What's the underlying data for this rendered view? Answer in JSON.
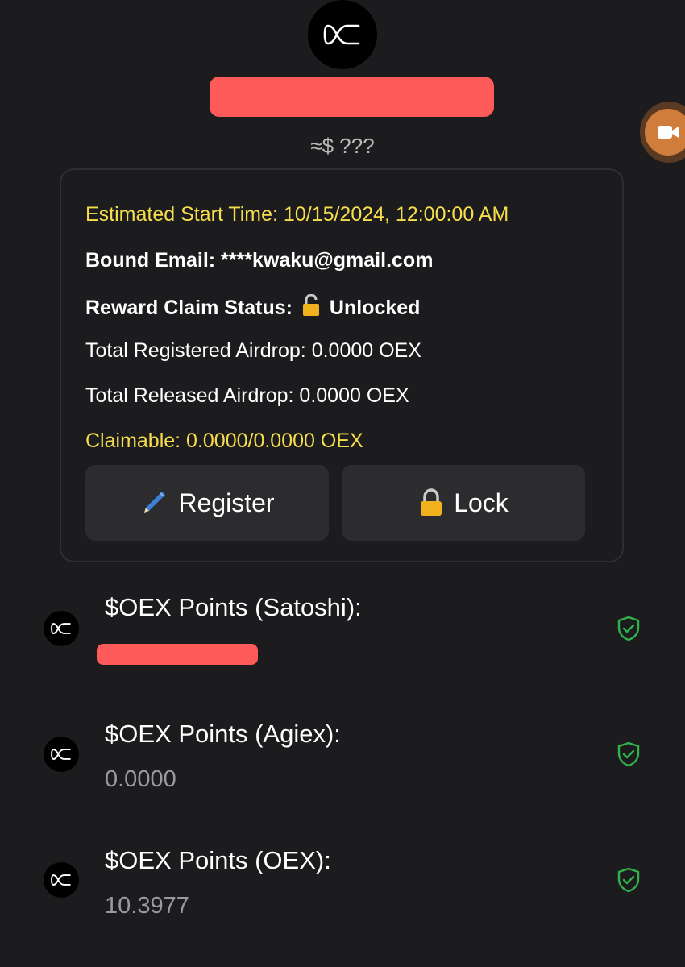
{
  "header": {
    "approx_value": "≈$ ???"
  },
  "card": {
    "start_time": "Estimated Start Time: 10/15/2024, 12:00:00 AM",
    "email_label": "Bound Email: ****kwaku@gmail.com",
    "claim_status_label": "Reward Claim Status:",
    "claim_status_value": "Unlocked",
    "total_registered": "Total Registered Airdrop: 0.0000 OEX",
    "total_released": "Total Released Airdrop: 0.0000 OEX",
    "claimable": "Claimable: 0.0000/0.0000 OEX",
    "register_label": "Register",
    "lock_label": "Lock"
  },
  "points": [
    {
      "title": "$OEX Points (Satoshi):",
      "value": ""
    },
    {
      "title": "$OEX Points (Agiex):",
      "value": "0.0000"
    },
    {
      "title": "$OEX Points (OEX):",
      "value": "10.3977"
    }
  ],
  "colors": {
    "background": "#1c1c1e",
    "accent_yellow": "#f6dd4c",
    "redaction": "#ff5a5a",
    "shield_green": "#2fb34a"
  }
}
